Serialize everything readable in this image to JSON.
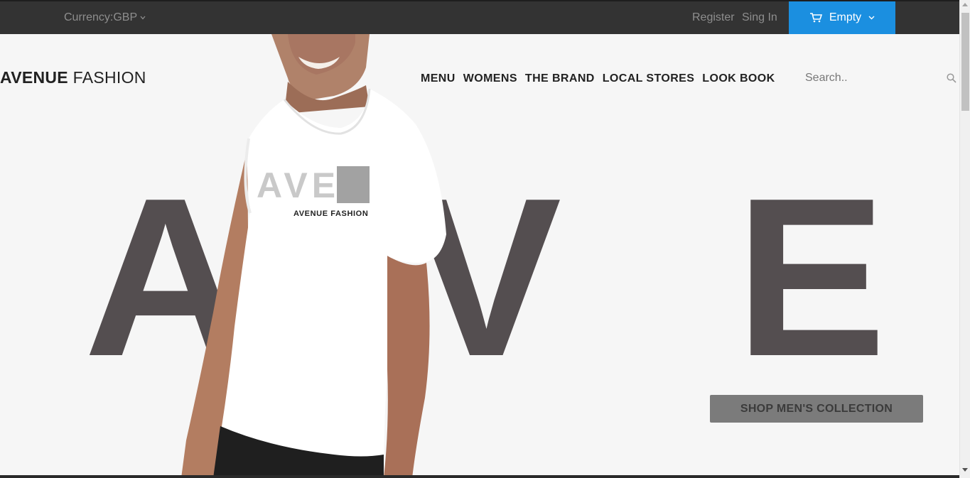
{
  "topbar": {
    "currency_label": "Currency:GBP",
    "register_label": "Register",
    "signin_label": "Sing In",
    "cart_label": "Empty",
    "cart_color": "#1b8fe0"
  },
  "header": {
    "logo_bold": "AVENUE",
    "logo_light": "FASHION",
    "nav": [
      "MENU",
      "WOMENS",
      "THE BRAND",
      "LOCAL STORES",
      "LOOK BOOK"
    ],
    "search_placeholder": "Search.."
  },
  "hero": {
    "letters": [
      "A",
      "V",
      "E"
    ],
    "shirt_print_letters": "AVE",
    "shirt_print_text": "AVENUE FASHION",
    "cta_label": "SHOP MEN'S COLLECTION",
    "letter_color": "#544e50"
  },
  "icons": {
    "cart": "cart-icon",
    "search": "search-icon",
    "chevron": "chevron-down-icon"
  }
}
